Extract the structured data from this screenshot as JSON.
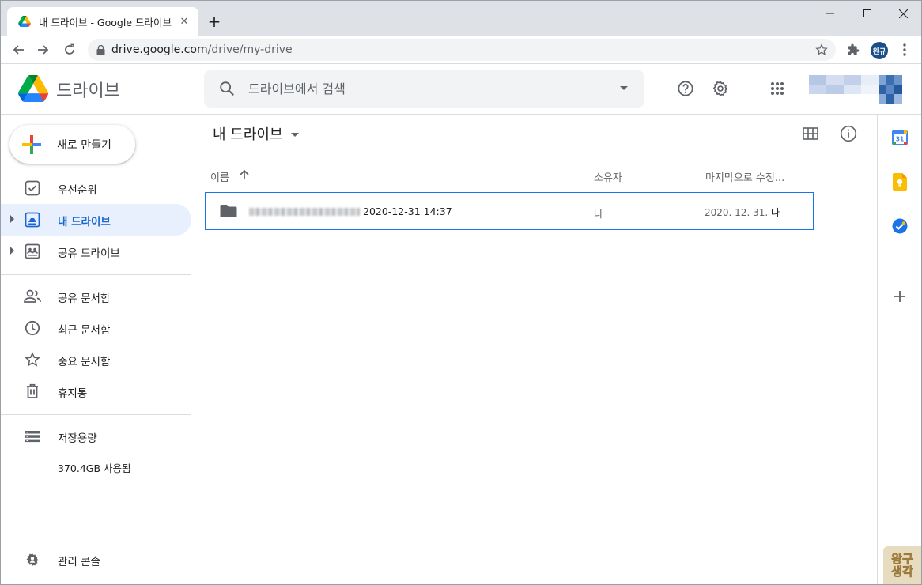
{
  "browser": {
    "tab_title": "내 드라이브 - Google 드라이브",
    "url_host": "drive.google.com",
    "url_path": "/drive/my-drive",
    "profile_initials": "완규"
  },
  "header": {
    "product_name": "드라이브",
    "search_placeholder": "드라이브에서 검색"
  },
  "nav": {
    "new_label": "새로 만들기",
    "items": [
      {
        "label": "우선순위",
        "icon": "priority-check-icon"
      },
      {
        "label": "내 드라이브",
        "icon": "my-drive-icon",
        "active": true
      },
      {
        "label": "공유 드라이브",
        "icon": "shared-drives-icon"
      },
      {
        "label": "공유 문서함",
        "icon": "people-icon"
      },
      {
        "label": "최근 문서함",
        "icon": "clock-icon"
      },
      {
        "label": "중요 문서함",
        "icon": "star-icon"
      },
      {
        "label": "휴지통",
        "icon": "trash-icon"
      }
    ],
    "storage_label": "저장용량",
    "storage_used": "370.4GB 사용됨",
    "admin_console": "관리 콘솔"
  },
  "main": {
    "breadcrumb": "내 드라이브",
    "columns": {
      "name": "이름",
      "owner": "소유자",
      "modified": "마지막으로 수정..."
    },
    "files": [
      {
        "name_suffix": "2020-12-31 14:37",
        "owner": "나",
        "modified_date": "2020. 12. 31.",
        "modified_by": "나",
        "type": "folder"
      }
    ]
  },
  "watermark": {
    "line1": "왕구",
    "line2": "생각"
  },
  "colors": {
    "accent": "#1a73e8",
    "active_nav_bg": "#e8f0fe",
    "active_nav_text": "#1967d2"
  }
}
